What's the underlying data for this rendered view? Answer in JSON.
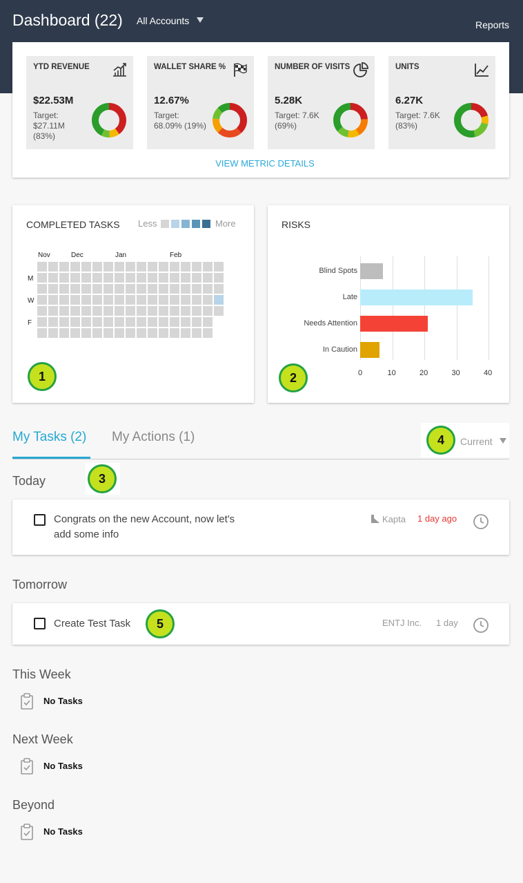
{
  "header": {
    "title": "Dashboard (22)",
    "account_selector": "All Accounts",
    "reports_link": "Reports",
    "background_color": "#2f3b4c"
  },
  "metrics": {
    "items": [
      {
        "label": "YTD REVENUE",
        "value": "$22.53M",
        "target": "Target: $27.11M (83%)",
        "icon": "bar-chart-growth-icon"
      },
      {
        "label": "WALLET SHARE %",
        "value": "12.67%",
        "target": "Target: 68.09% (19%)",
        "icon": "checkered-flag-icon"
      },
      {
        "label": "NUMBER OF VISITS",
        "value": "5.28K",
        "target": "Target: 7.6K (69%)",
        "icon": "pie-chart-icon"
      },
      {
        "label": "UNITS",
        "value": "6.27K",
        "target": "Target: 7.6K (83%)",
        "icon": "line-chart-icon"
      }
    ],
    "view_details": "VIEW METRIC DETAILS"
  },
  "completed_tasks": {
    "title": "COMPLETED TASKS",
    "legend_less": "Less",
    "legend_more": "More",
    "legend_colors": [
      "#d6d6d6",
      "#b8d4e8",
      "#86b5d3",
      "#5a93b8",
      "#3a6f94"
    ],
    "months": [
      "Nov",
      "Dec",
      "Jan",
      "Feb"
    ],
    "days": [
      "M",
      "W",
      "F"
    ],
    "highlighted_color": "#b8d4e8"
  },
  "risks": {
    "title": "RISKS",
    "chart_data": {
      "type": "bar",
      "orientation": "horizontal",
      "categories": [
        "Blind Spots",
        "Late",
        "Needs Attention",
        "In Caution"
      ],
      "values": [
        7,
        35,
        21,
        6
      ],
      "colors": [
        "#bdbdbd",
        "#b8ecfb",
        "#f44336",
        "#e0a300"
      ],
      "xlim": [
        0,
        40
      ],
      "xticks": [
        "0",
        "10",
        "20",
        "30",
        "40"
      ],
      "grid": true
    }
  },
  "tabs": {
    "my_tasks": "My Tasks (2)",
    "my_actions": "My Actions (1)",
    "filter": "Current"
  },
  "sections": {
    "today": "Today",
    "tomorrow": "Tomorrow",
    "this_week": "This Week",
    "next_week": "Next Week",
    "beyond": "Beyond",
    "no_tasks": "No Tasks"
  },
  "tasks": {
    "today": {
      "line1": "Congrats on the new Account, now let's",
      "line2": "add some info",
      "account": "Kapta",
      "due": "1 day ago",
      "due_color": "#e53935"
    },
    "tomorrow": {
      "text": "Create Test Task",
      "account": "ENTJ Inc.",
      "due": "1 day",
      "due_color": "#999999"
    }
  },
  "badges": [
    "1",
    "2",
    "3",
    "4",
    "5"
  ],
  "accent_color": "#26a7d1"
}
